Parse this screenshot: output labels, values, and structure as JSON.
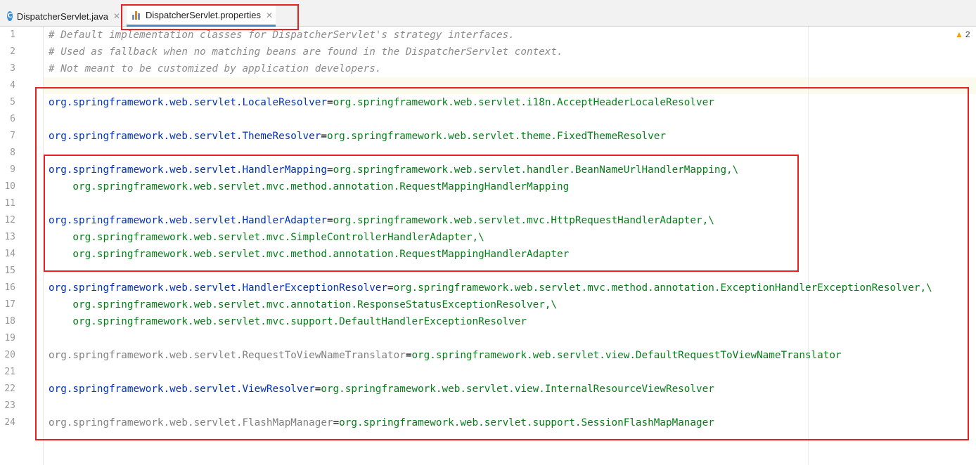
{
  "tabs": [
    {
      "label": "DispatcherServlet.java",
      "icon": "java-class-icon",
      "active": false
    },
    {
      "label": "DispatcherServlet.properties",
      "icon": "properties-file-icon",
      "active": true
    }
  ],
  "inspections": {
    "warning_count": "2"
  },
  "colors": {
    "comment": "#8c8c8c",
    "key": "#0033b3",
    "key_unused": "#808080",
    "value": "#067d17",
    "highlight_box": "#e82020"
  },
  "editor": {
    "lines": [
      {
        "n": "1",
        "type": "comment",
        "text": "# Default implementation classes for DispatcherServlet's strategy interfaces."
      },
      {
        "n": "2",
        "type": "comment",
        "text": "# Used as fallback when no matching beans are found in the DispatcherServlet context."
      },
      {
        "n": "3",
        "type": "comment",
        "text": "# Not meant to be customized by application developers."
      },
      {
        "n": "4",
        "type": "blank"
      },
      {
        "n": "5",
        "type": "prop",
        "key": "org.springframework.web.servlet.LocaleResolver",
        "value": "org.springframework.web.servlet.i18n.AcceptHeaderLocaleResolver"
      },
      {
        "n": "6",
        "type": "blank"
      },
      {
        "n": "7",
        "type": "prop",
        "key": "org.springframework.web.servlet.ThemeResolver",
        "value": "org.springframework.web.servlet.theme.FixedThemeResolver"
      },
      {
        "n": "8",
        "type": "blank"
      },
      {
        "n": "9",
        "type": "prop",
        "key": "org.springframework.web.servlet.HandlerMapping",
        "value": "org.springframework.web.servlet.handler.BeanNameUrlHandlerMapping,\\"
      },
      {
        "n": "10",
        "type": "cont",
        "value": "    org.springframework.web.servlet.mvc.method.annotation.RequestMappingHandlerMapping"
      },
      {
        "n": "11",
        "type": "blank"
      },
      {
        "n": "12",
        "type": "prop",
        "key": "org.springframework.web.servlet.HandlerAdapter",
        "value": "org.springframework.web.servlet.mvc.HttpRequestHandlerAdapter,\\"
      },
      {
        "n": "13",
        "type": "cont",
        "value": "    org.springframework.web.servlet.mvc.SimpleControllerHandlerAdapter,\\"
      },
      {
        "n": "14",
        "type": "cont",
        "value": "    org.springframework.web.servlet.mvc.method.annotation.RequestMappingHandlerAdapter"
      },
      {
        "n": "15",
        "type": "blank"
      },
      {
        "n": "16",
        "type": "prop",
        "key": "org.springframework.web.servlet.HandlerExceptionResolver",
        "value": "org.springframework.web.servlet.mvc.method.annotation.ExceptionHandlerExceptionResolver,\\"
      },
      {
        "n": "17",
        "type": "cont",
        "value": "    org.springframework.web.servlet.mvc.annotation.ResponseStatusExceptionResolver,\\"
      },
      {
        "n": "18",
        "type": "cont",
        "value": "    org.springframework.web.servlet.mvc.support.DefaultHandlerExceptionResolver"
      },
      {
        "n": "19",
        "type": "blank"
      },
      {
        "n": "20",
        "type": "prop-unused",
        "key": "org.springframework.web.servlet.RequestToViewNameTranslator",
        "value": "org.springframework.web.servlet.view.DefaultRequestToViewNameTranslator"
      },
      {
        "n": "21",
        "type": "blank"
      },
      {
        "n": "22",
        "type": "prop",
        "key": "org.springframework.web.servlet.ViewResolver",
        "value": "org.springframework.web.servlet.view.InternalResourceViewResolver"
      },
      {
        "n": "23",
        "type": "blank"
      },
      {
        "n": "24",
        "type": "prop-unused",
        "key": "org.springframework.web.servlet.FlashMapManager",
        "value": "org.springframework.web.servlet.support.SessionFlashMapManager"
      }
    ]
  }
}
